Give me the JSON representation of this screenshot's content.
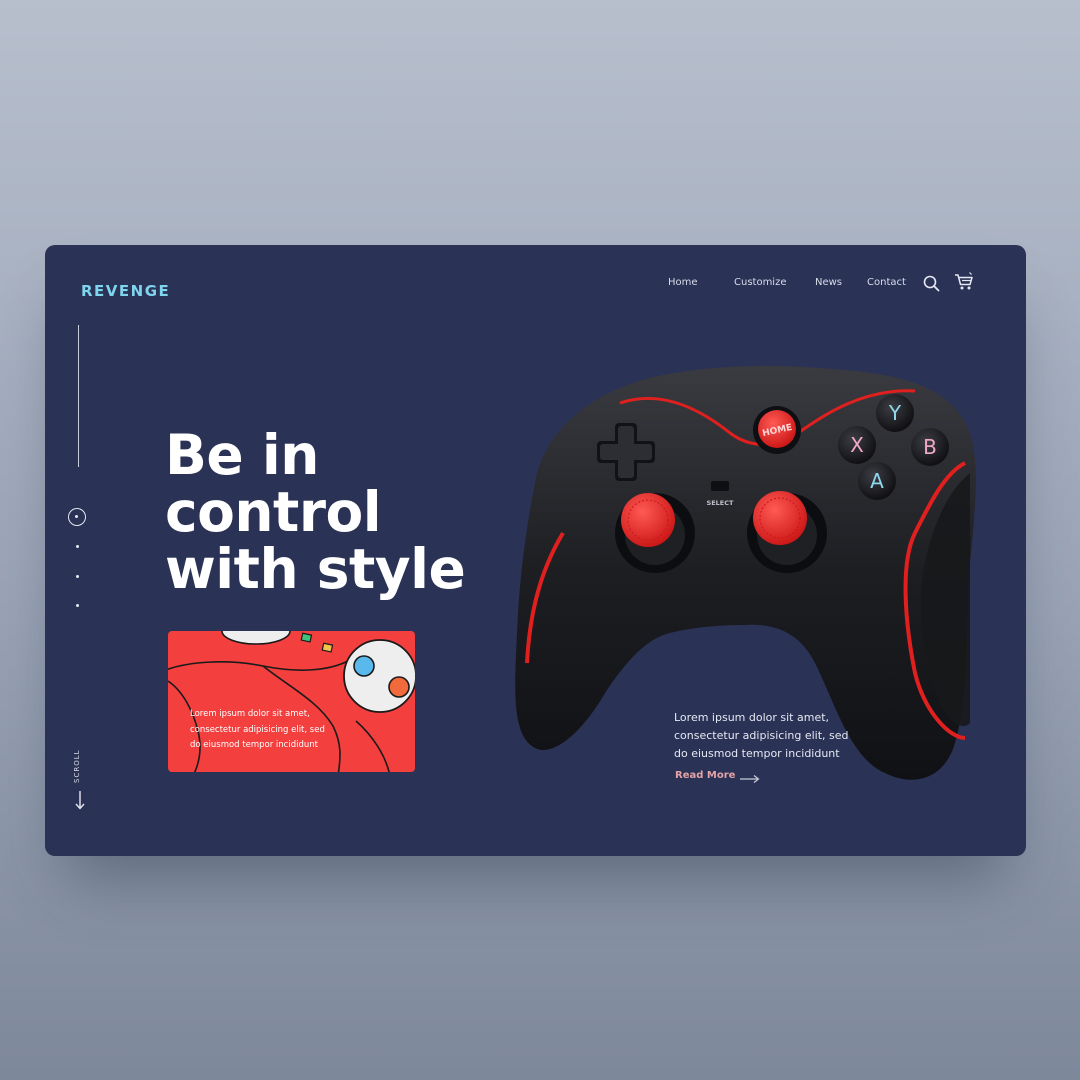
{
  "brand": {
    "name": "REVENGE"
  },
  "nav": {
    "items": [
      {
        "label": "Home"
      },
      {
        "label": "Customize"
      },
      {
        "label": "News"
      },
      {
        "label": "Contact"
      }
    ]
  },
  "icons": {
    "search": "search-icon",
    "cart": "cart-icon",
    "scroll_arrow": "arrow-down-icon",
    "read_more_arrow": "arrow-right-icon"
  },
  "hero": {
    "headline_lines": [
      "Be in",
      "control",
      "with style"
    ]
  },
  "side": {
    "scroll_label": "SCROLL",
    "pager_count": 4,
    "active_page": 1
  },
  "promo_card": {
    "text_lines": [
      "Lorem ipsum dolor sit amet,",
      "consectetur adipisicing elit, sed",
      "do eiusmod tempor incididunt"
    ]
  },
  "product": {
    "description_lines": [
      "Lorem ipsum dolor sit amet,",
      "consectetur adipisicing elit, sed",
      "do eiusmod tempor incididunt"
    ],
    "read_more_label": "Read More",
    "controller_labels": {
      "home": "HOME",
      "select": "SELECT",
      "y": "Y",
      "x": "X",
      "b": "B",
      "a": "A"
    }
  },
  "colors": {
    "background": "#2a3255",
    "brand": "#7fd4ee",
    "accent_red": "#f43f3f",
    "read_more": "#e3a2a8",
    "text_light": "#e6e9f3"
  }
}
